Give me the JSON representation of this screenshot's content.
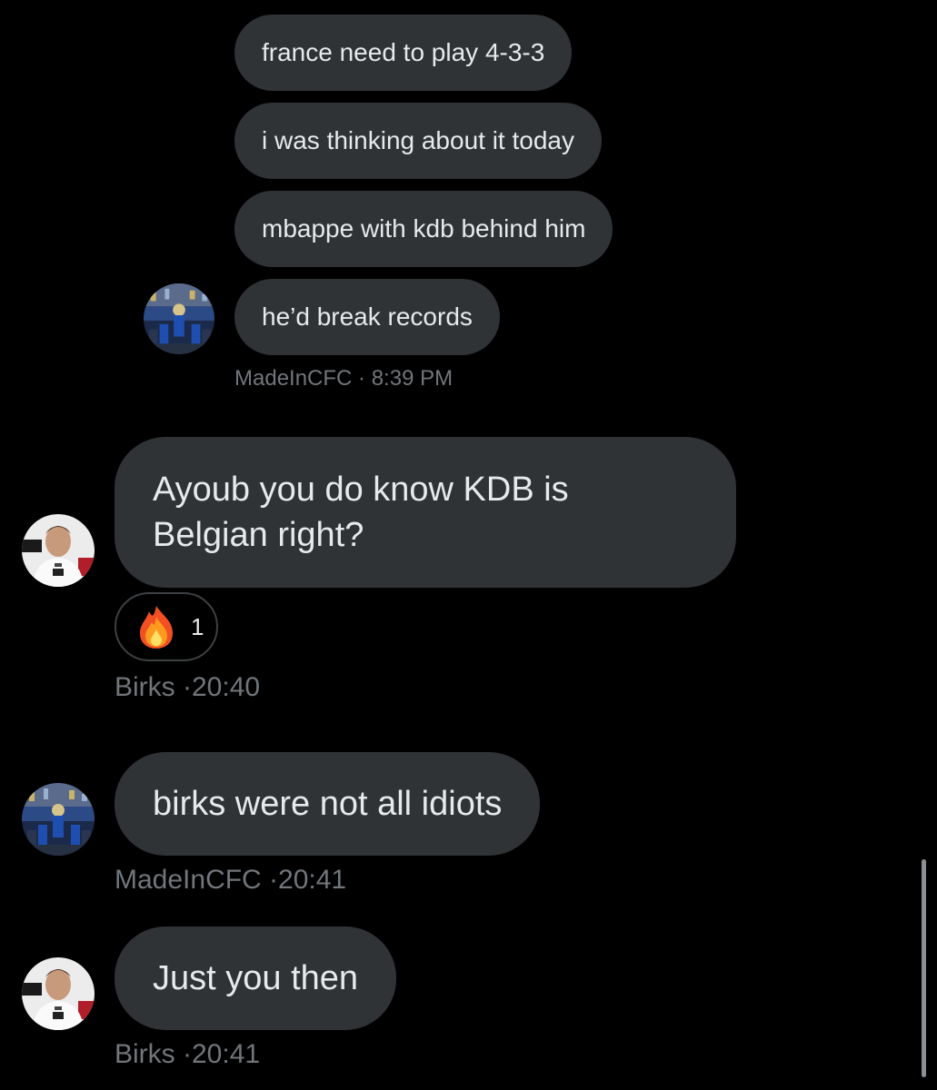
{
  "thread": {
    "messages": [
      {
        "text": "france need to play 4-3-3"
      },
      {
        "text": "i was thinking about it today"
      },
      {
        "text": "mbappe with kdb behind him"
      },
      {
        "text": "he’d break records"
      },
      {
        "text_line1": "Ayoub you do know KDB is",
        "text_line2": "Belgian right?"
      },
      {
        "text": "birks were not all idiots"
      },
      {
        "text": "Just you then"
      }
    ],
    "meta": [
      {
        "sender": "MadeInCFC",
        "sep": " · ",
        "time": "8:39 PM"
      },
      {
        "sender": "Birks",
        "sep": " ·",
        "time": "20:40"
      },
      {
        "sender": "MadeInCFC",
        "sep": " ·",
        "time": "20:41"
      },
      {
        "sender": "Birks",
        "sep": " ·",
        "time": "20:41"
      }
    ],
    "reaction": {
      "emoji": "fire-emoji",
      "count": "1"
    }
  },
  "colors": {
    "background": "#000000",
    "bubble": "#2f3336",
    "text": "#e7e9ea",
    "meta": "#71767b"
  }
}
